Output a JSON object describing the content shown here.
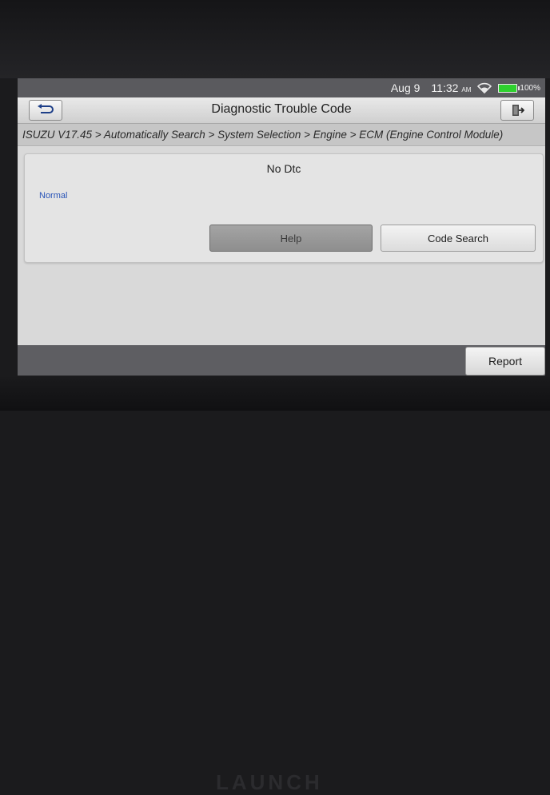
{
  "statusbar": {
    "date": "Aug 9",
    "time": "11:32",
    "ampm": "AM",
    "battery": "100%",
    "battery_level": 1.0
  },
  "header": {
    "title": "Diagnostic Trouble Code",
    "back_icon": "back-arrow-icon",
    "exit_icon": "exit-door-icon"
  },
  "breadcrumb": "ISUZU V17.45 > Automatically Search > System Selection > Engine > ECM (Engine Control Module)",
  "result": {
    "heading": "No Dtc",
    "status": "Normal",
    "help_label": "Help",
    "code_search_label": "Code Search"
  },
  "footer": {
    "report_label": "Report"
  },
  "device_brand": "LAUNCH",
  "colors": {
    "status_text": "#2a55b8",
    "battery": "#2ed12e",
    "bottombar": "#5e5e62"
  }
}
